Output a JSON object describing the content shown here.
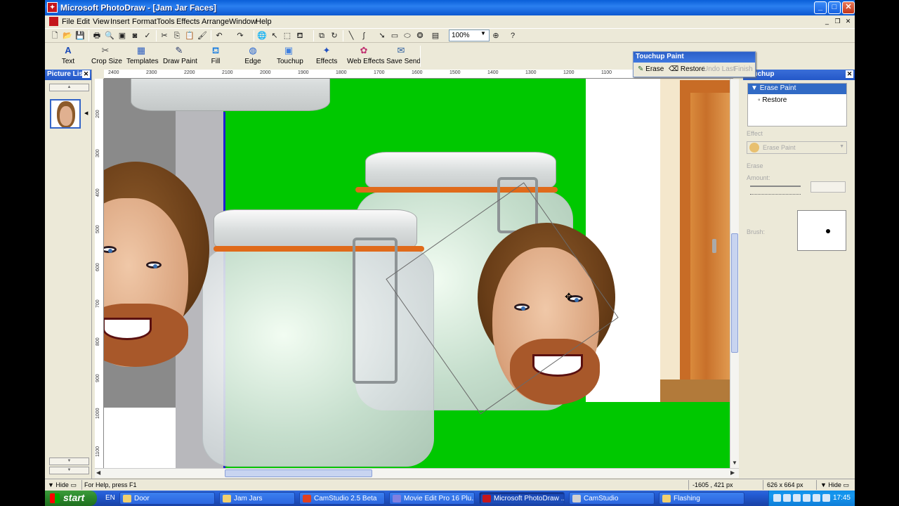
{
  "window": {
    "title": "Microsoft PhotoDraw - [Jam Jar Faces]",
    "icon_text": "✦",
    "min_glyph": "_",
    "max_glyph": "□",
    "close_glyph": "✕"
  },
  "menu": {
    "items": [
      "File",
      "Edit",
      "View",
      "Insert",
      "Format",
      "Tools",
      "Effects",
      "Arrange",
      "Window",
      "Help"
    ]
  },
  "toolbar": {
    "zoom_value": "100%"
  },
  "tools": {
    "items": [
      "Text",
      "Crop Size",
      "Templates",
      "Draw Paint",
      "Fill",
      "Edge",
      "Touchup",
      "Effects",
      "Web Effects",
      "Save Send"
    ]
  },
  "touchup_bar": {
    "title": "Touchup Paint",
    "erase": "Erase",
    "restore": "Restore",
    "undo_last": "Undo Last",
    "finish": "Finish"
  },
  "picture_list": {
    "title": "Picture List",
    "close_glyph": "✕"
  },
  "ruler_top": [
    "2400",
    "2300",
    "2200",
    "2100",
    "2000",
    "1900",
    "1800",
    "1700",
    "1600",
    "1500",
    "1400",
    "1300",
    "1200",
    "1100",
    "1000"
  ],
  "ruler_left": [
    "200",
    "300",
    "400",
    "500",
    "600",
    "700",
    "800",
    "900",
    "1000",
    "1100"
  ],
  "right_panel": {
    "title": "Touchup",
    "list_selected": "Erase Paint",
    "list_option": "Restore",
    "effect_label": "Effect",
    "effect_value": "Erase Paint",
    "erase_label": "Erase",
    "amount_label": "Amount:",
    "brush_label": "Brush:"
  },
  "status": {
    "hide_label": "Hide",
    "help_text": "For Help, press F1",
    "coords": "-1605 , 421 px",
    "size": "626 x 664 px",
    "hide_label_right": "Hide"
  },
  "taskbar": {
    "start_label": "start",
    "language": "EN",
    "tasks": [
      {
        "label": "Door",
        "color": "#f0d070",
        "active": false
      },
      {
        "label": "Jam Jars",
        "color": "#f0d070",
        "active": false
      },
      {
        "label": "CamStudio 2.5 Beta",
        "color": "#e04020",
        "active": false
      },
      {
        "label": "Movie Edit Pro 16 Plu...",
        "color": "#8080e0",
        "active": false
      },
      {
        "label": "Microsoft PhotoDraw ...",
        "color": "#c4161c",
        "active": true
      },
      {
        "label": "CamStudio",
        "color": "#d0d0d0",
        "active": false
      },
      {
        "label": "Flashing",
        "color": "#f0d070",
        "active": false
      }
    ],
    "clock": "17:45"
  }
}
